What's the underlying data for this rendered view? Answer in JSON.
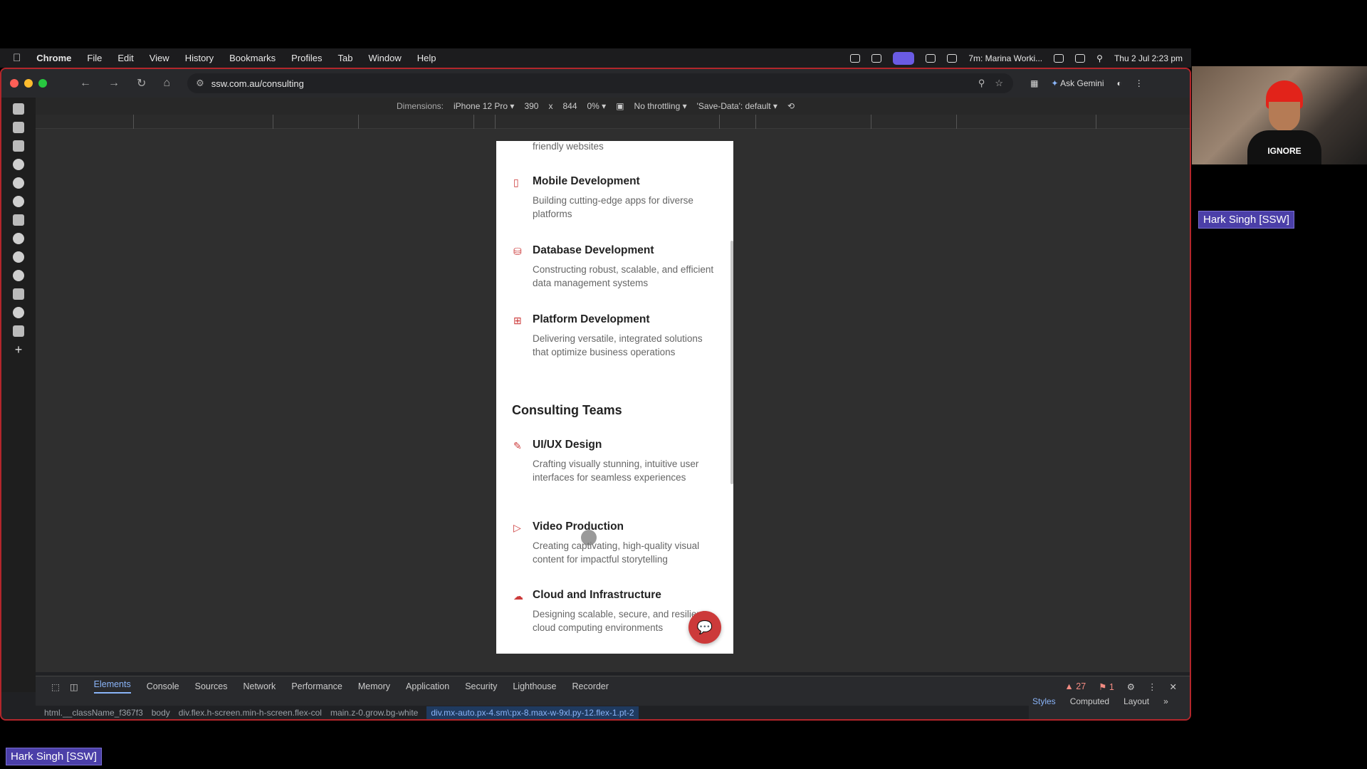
{
  "menubar": {
    "app": "Chrome",
    "items": [
      "File",
      "Edit",
      "View",
      "History",
      "Bookmarks",
      "Profiles",
      "Tab",
      "Window",
      "Help"
    ],
    "meeting_status": "7m: Marina Worki...",
    "datetime": "Thu 2 Jul  2:23 pm"
  },
  "browser": {
    "url": "ssw.com.au/consulting",
    "ask_gemini": "Ask Gemini"
  },
  "device_toolbar": {
    "dimensions_label": "Dimensions:",
    "device": "iPhone 12 Pro",
    "width": "390",
    "times": "x",
    "height": "844",
    "zoom": "0%",
    "throttling": "No throttling",
    "save_data": "'Save-Data': default"
  },
  "page": {
    "top_fragment": "friendly websites",
    "services": [
      {
        "title": "Mobile Development",
        "desc": "Building cutting-edge apps for diverse platforms",
        "icon": "mobile-icon"
      },
      {
        "title": "Database Development",
        "desc": "Constructing robust, scalable, and efficient data management systems",
        "icon": "database-icon"
      },
      {
        "title": "Platform Development",
        "desc": "Delivering versatile, integrated solutions that optimize business operations",
        "icon": "grid-icon"
      }
    ],
    "section_title": "Consulting Teams",
    "teams": [
      {
        "title": "UI/UX Design",
        "desc": "Crafting visually stunning, intuitive user interfaces for seamless experiences",
        "icon": "pen-tool-icon"
      },
      {
        "title": "Video Production",
        "desc": "Creating captivating, high-quality visual content for impactful storytelling",
        "icon": "video-icon"
      },
      {
        "title": "Cloud and Infrastructure",
        "desc": "Designing scalable, secure, and resilient cloud computing environments",
        "icon": "cloud-icon"
      }
    ],
    "accent": "#cc3a3a"
  },
  "devtools": {
    "tabs": [
      "Elements",
      "Console",
      "Sources",
      "Network",
      "Performance",
      "Memory",
      "Application",
      "Security",
      "Lighthouse",
      "Recorder"
    ],
    "warnings": "27",
    "issues": "1",
    "breadcrumbs": [
      "html.__className_f367f3",
      "body",
      "div.flex.h-screen.min-h-screen.flex-col",
      "main.z-0.grow.bg-white",
      "div.mx-auto.px-4.sm\\:px-8.max-w-9xl.py-12.flex-1.pt-2"
    ],
    "side_tabs": [
      "Styles",
      "Computed",
      "Layout"
    ]
  },
  "webcam": {
    "participant": "Hark Singh [SSW]",
    "shirt_text": "IGNORE"
  },
  "bottom_label": "Hark Singh [SSW]"
}
